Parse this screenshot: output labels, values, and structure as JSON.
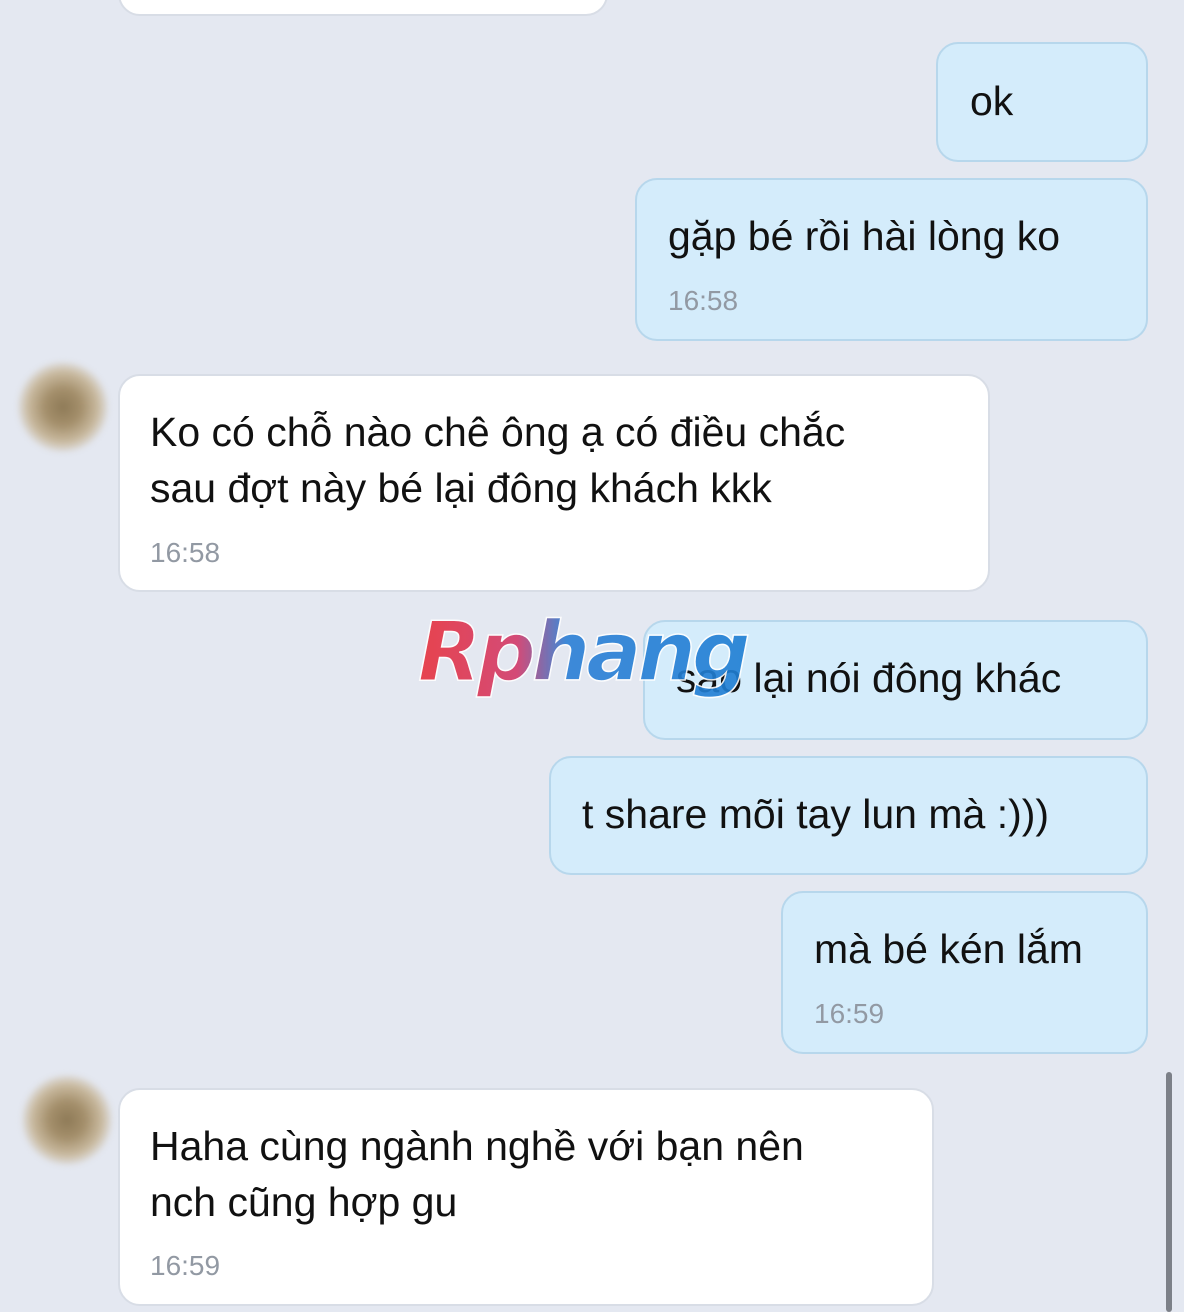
{
  "messages": [
    {
      "id": "m1",
      "direction": "outgoing",
      "text": "ok"
    },
    {
      "id": "m2",
      "direction": "outgoing",
      "text": "gặp bé rồi hài lòng ko",
      "time": "16:58"
    },
    {
      "id": "m3",
      "direction": "incoming",
      "lines": [
        "Ko có chỗ nào chê ông ạ có điều chắc",
        "sau đợt này bé lại đông khách kkk"
      ],
      "time": "16:58"
    },
    {
      "id": "m4",
      "direction": "outgoing",
      "text": "sao lại nói đông khác"
    },
    {
      "id": "m5",
      "direction": "outgoing",
      "text": "t share mõi tay lun mà :)))"
    },
    {
      "id": "m6",
      "direction": "outgoing",
      "text": "mà bé kén lắm",
      "time": "16:59"
    },
    {
      "id": "m7",
      "direction": "incoming",
      "lines": [
        "Haha cùng ngành nghề với bạn nên",
        "nch cũng hợp gu"
      ],
      "time": "16:59"
    }
  ],
  "watermark": {
    "text": "Rphang"
  },
  "colors": {
    "background": "#e4e8f1",
    "outgoing_bubble": "#d4ecfb",
    "incoming_bubble": "#ffffff",
    "timestamp": "#9299a3",
    "watermark_red": "#e8323c",
    "watermark_blue": "#1f7fd4"
  }
}
